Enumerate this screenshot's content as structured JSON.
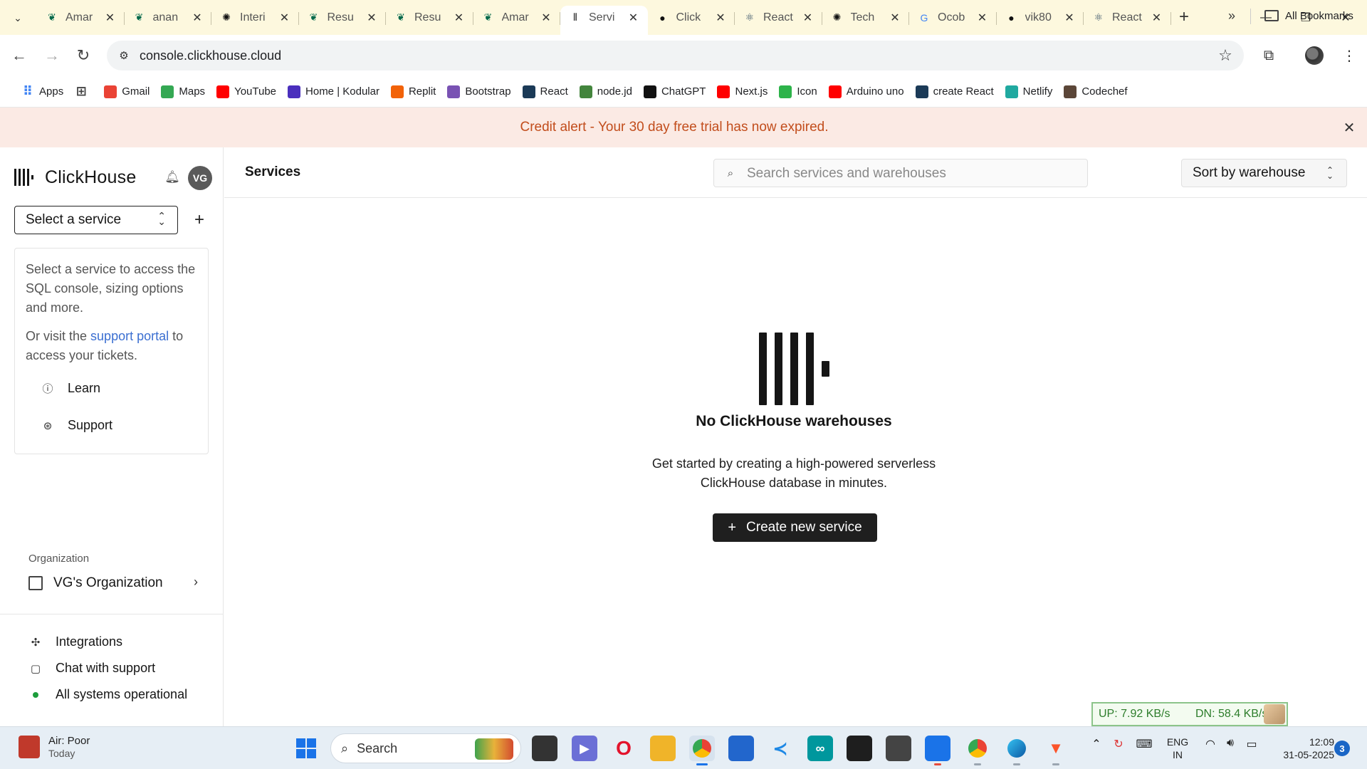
{
  "browser": {
    "tabs": [
      {
        "title": "Amar",
        "icon": "mongodb-leaf-icon",
        "color": "#00684a"
      },
      {
        "title": "anan",
        "icon": "mongodb-leaf-icon",
        "color": "#00684a"
      },
      {
        "title": "Interi",
        "icon": "openai-icon",
        "color": "#111111"
      },
      {
        "title": "Resu",
        "icon": "mongodb-leaf-icon",
        "color": "#00684a"
      },
      {
        "title": "Resu",
        "icon": "mongodb-leaf-icon",
        "color": "#00684a"
      },
      {
        "title": "Amar",
        "icon": "mongodb-leaf-icon",
        "color": "#00684a"
      },
      {
        "title": "Servi",
        "icon": "clickhouse-icon",
        "color": "#151515",
        "active": true
      },
      {
        "title": "Click",
        "icon": "github-icon",
        "color": "#111111"
      },
      {
        "title": "React",
        "icon": "react-icon",
        "color": "#1b3a57"
      },
      {
        "title": "Tech",
        "icon": "openai-icon",
        "color": "#111111"
      },
      {
        "title": "Ocob",
        "icon": "google-icon",
        "color": "#4285f4"
      },
      {
        "title": "vik80",
        "icon": "github-icon",
        "color": "#111111"
      },
      {
        "title": "React",
        "icon": "react-icon",
        "color": "#1b3a57"
      }
    ],
    "url": "console.clickhouse.cloud",
    "bookmarks": [
      {
        "label": "Apps",
        "icon": "apps-grid-icon",
        "color": "#4285f4"
      },
      {
        "label": "",
        "icon": "tab-groups-icon",
        "color": "#444444"
      },
      {
        "label": "Gmail",
        "icon": "gmail-icon",
        "color": "#ea4335"
      },
      {
        "label": "Maps",
        "icon": "maps-pin-icon",
        "color": "#34a853"
      },
      {
        "label": "YouTube",
        "icon": "youtube-icon",
        "color": "#ff0000"
      },
      {
        "label": "Home | Kodular",
        "icon": "kodular-icon",
        "color": "#4a2fbd"
      },
      {
        "label": "Replit",
        "icon": "replit-icon",
        "color": "#f26207"
      },
      {
        "label": "Bootstrap",
        "icon": "bootstrap-icon",
        "color": "#7952b3"
      },
      {
        "label": "React",
        "icon": "react-icon",
        "color": "#1b3a57"
      },
      {
        "label": "node.jd",
        "icon": "nodejs-icon",
        "color": "#43853d"
      },
      {
        "label": "ChatGPT",
        "icon": "openai-icon",
        "color": "#111111"
      },
      {
        "label": "Next.js",
        "icon": "youtube-icon",
        "color": "#ff0000"
      },
      {
        "label": "Icon",
        "icon": "icon-site-icon",
        "color": "#2db34a"
      },
      {
        "label": "Arduino uno",
        "icon": "youtube-icon",
        "color": "#ff0000"
      },
      {
        "label": "create React",
        "icon": "react-icon",
        "color": "#1b3a57"
      },
      {
        "label": "Netlify",
        "icon": "netlify-icon",
        "color": "#20a9a0"
      },
      {
        "label": "Codechef",
        "icon": "codechef-icon",
        "color": "#5b4638"
      }
    ],
    "all_bookmarks": "All Bookmarks"
  },
  "alert": {
    "message": "Credit alert - Your 30 day free trial has now expired."
  },
  "sidebar": {
    "brand": "ClickHouse",
    "avatar_initials": "VG",
    "service_select": "Select a service",
    "info_text": "Select a service to access the SQL console, sizing options and more.",
    "visit_prefix": "Or visit the",
    "support_link": "support portal",
    "visit_suffix": "to access your tickets.",
    "learn": "Learn",
    "support": "Support",
    "org_label": "Organization",
    "org_name": "VG's Organization",
    "integrations": "Integrations",
    "chat": "Chat with support",
    "status": "All systems operational",
    "status_color": "#1d9d3c"
  },
  "main": {
    "title": "Services",
    "search_placeholder": "Search services and warehouses",
    "sort": "Sort by warehouse",
    "empty_title": "No ClickHouse warehouses",
    "empty_desc_line1": "Get started by creating a high-powered serverless",
    "empty_desc_line2": "ClickHouse database in minutes.",
    "create_button": "Create new service"
  },
  "netspeed": {
    "up": "UP: 7.92 KB/s",
    "down": "DN: 58.4 KB/s"
  },
  "taskbar": {
    "weather_title": "Air: Poor",
    "weather_sub": "Today",
    "search": "Search",
    "lang_line1": "ENG",
    "lang_line2": "IN",
    "time": "12:09",
    "date": "31-05-2025",
    "notifications": "3"
  },
  "colors": {
    "alert_bg": "#fbeae4",
    "alert_text": "#c24d1c",
    "link": "#3b6fd1",
    "primary_button": "#1f1f1f"
  }
}
